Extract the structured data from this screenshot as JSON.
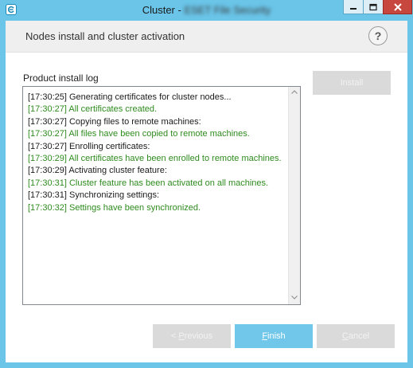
{
  "window": {
    "title_prefix": "Cluster - ",
    "title_redacted": "ESET File Security",
    "controls": {
      "minimize": "minimize-icon",
      "maximize": "maximize-icon",
      "close": "close-icon"
    }
  },
  "header": {
    "title": "Nodes install and cluster activation",
    "help_label": "?"
  },
  "log": {
    "label": "Product install log",
    "lines": [
      {
        "text": "[17:30:25] Generating certificates for cluster nodes...",
        "status": "info"
      },
      {
        "text": "[17:30:27] All certificates created.",
        "status": "success"
      },
      {
        "text": "[17:30:27] Copying files to remote machines:",
        "status": "info"
      },
      {
        "text": "[17:30:27] All files have been copied to remote machines.",
        "status": "success"
      },
      {
        "text": "[17:30:27] Enrolling certificates:",
        "status": "info"
      },
      {
        "text": "[17:30:29] All certificates have been enrolled to remote machines.",
        "status": "success"
      },
      {
        "text": "[17:30:29] Activating cluster feature:",
        "status": "info"
      },
      {
        "text": "[17:30:31] Cluster feature has been activated on all machines.",
        "status": "success"
      },
      {
        "text": "[17:30:31] Synchronizing settings:",
        "status": "info"
      },
      {
        "text": "[17:30:32] Settings have been synchronized.",
        "status": "success"
      }
    ]
  },
  "buttons": {
    "install": "Install",
    "previous_prefix": "< ",
    "previous_accel": "P",
    "previous_rest": "revious",
    "finish_accel": "F",
    "finish_rest": "inish",
    "cancel_accel": "C",
    "cancel_rest": "ancel"
  },
  "colors": {
    "accent": "#71c7ea",
    "success_text": "#2e8b1e",
    "close_button": "#c7463d"
  }
}
